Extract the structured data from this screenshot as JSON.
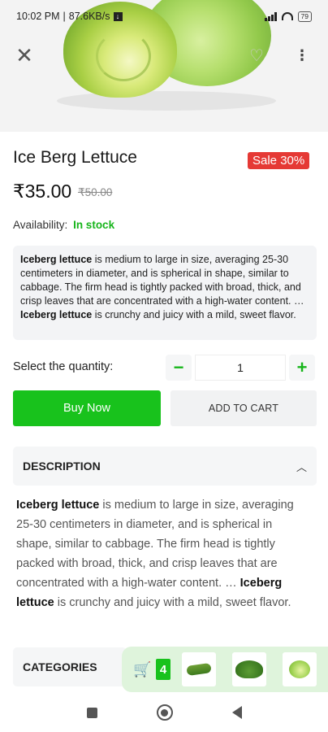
{
  "status_bar": {
    "time": "10:02 PM",
    "speed": "87.6KB/s",
    "battery": "79"
  },
  "icons": {
    "close": "close-icon",
    "wishlist": "heart-icon",
    "more": "more-vertical-icon",
    "cart": "cart-icon",
    "chevron": "chevron-up-icon"
  },
  "product": {
    "title": "Ice Berg Lettuce",
    "sale_badge": "Sale 30%",
    "price": "₹35.00",
    "old_price": "₹50.00",
    "availability_label": "Availability:",
    "availability_value": "In stock",
    "desc_bold_1": "Iceberg lettuce",
    "desc_mid": " is medium to large in size, averaging 25-30 centimeters in diameter, and is spherical in shape, similar to cabbage. The firm head is tightly packed with broad, thick, and crisp leaves that are concentrated with a high-water content. … ",
    "desc_bold_2": "Iceberg lettuce",
    "desc_end": " is crunchy and juicy with a mild, sweet flavor."
  },
  "quantity": {
    "label": "Select the quantity:",
    "minus": "−",
    "value": "1",
    "plus": "+"
  },
  "actions": {
    "buy_now": "Buy Now",
    "add_to_cart": "ADD TO CART"
  },
  "sections": {
    "description": "DESCRIPTION",
    "categories": "CATEGORIES"
  },
  "cart_strip": {
    "count": "4"
  },
  "colors": {
    "accent_green": "#18c21c",
    "sale_red": "#e53935"
  }
}
